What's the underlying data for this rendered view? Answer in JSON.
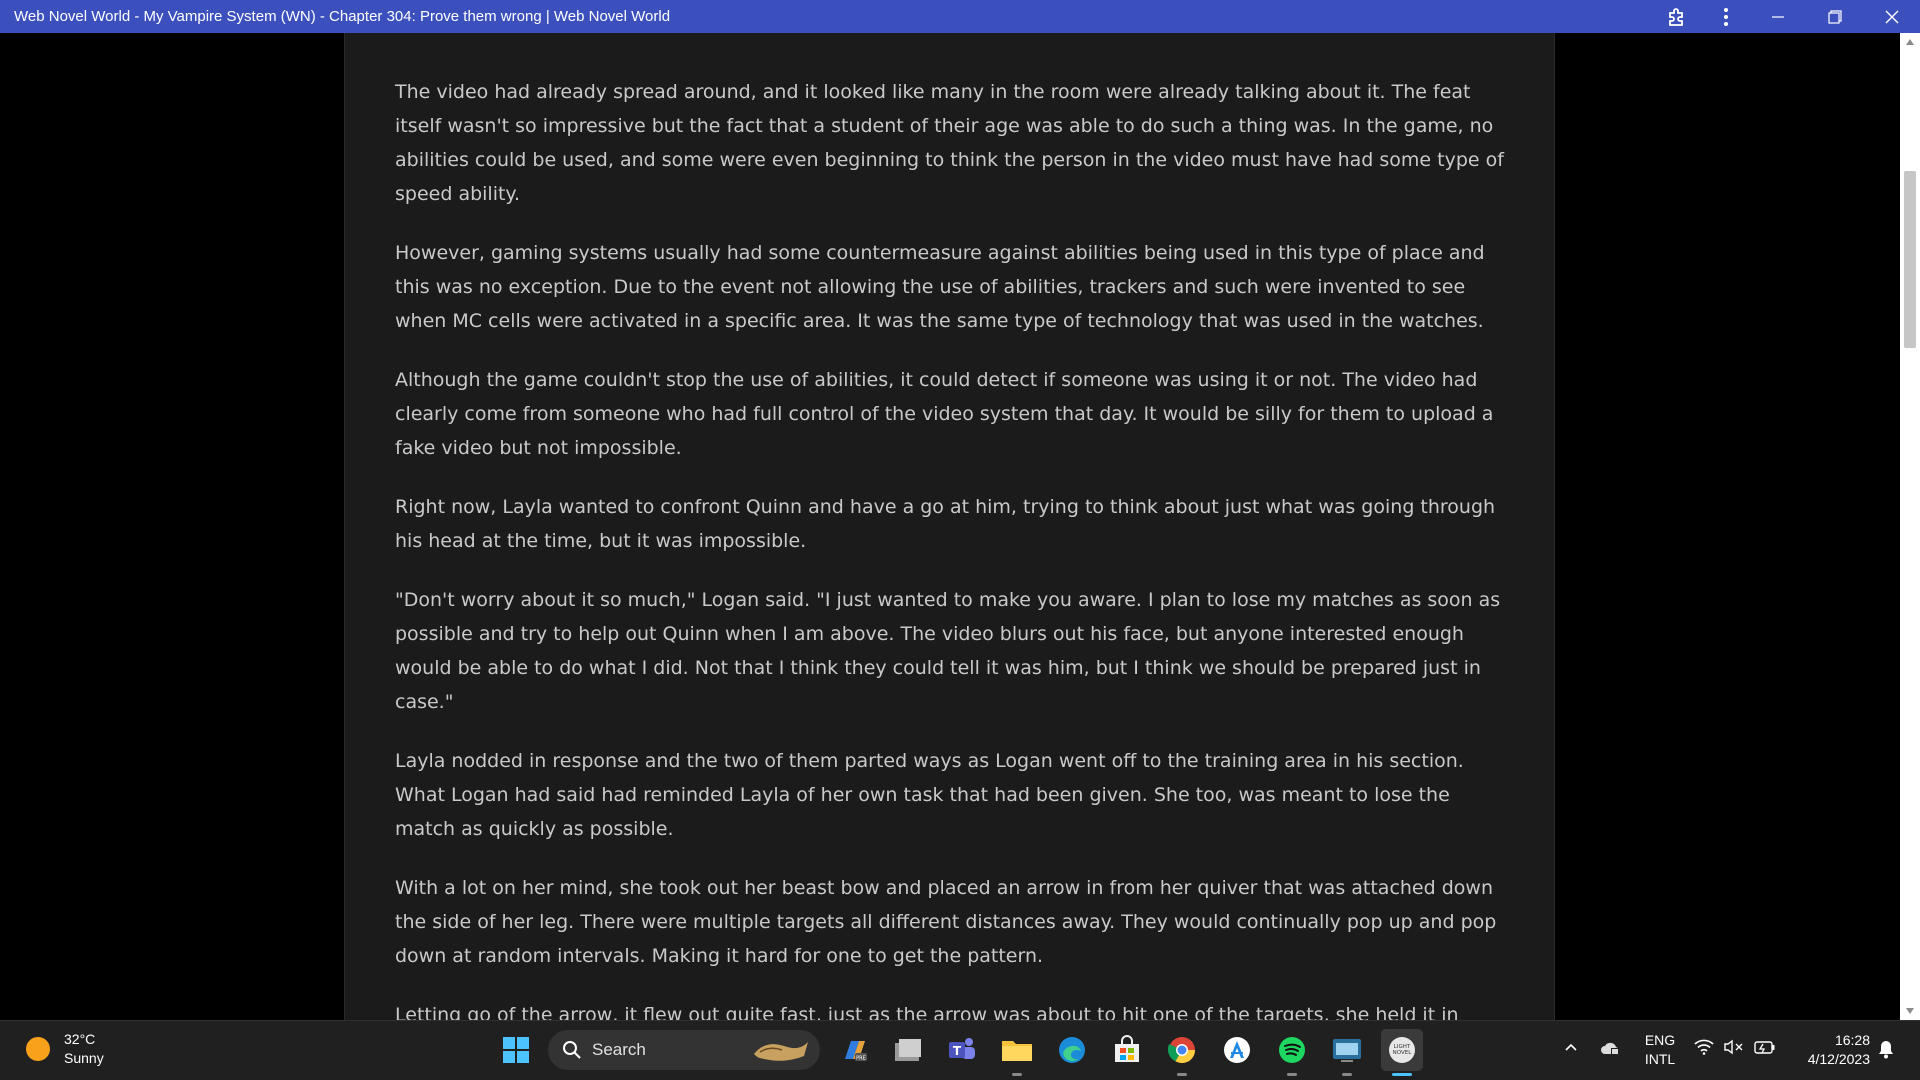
{
  "window": {
    "title": "Web Novel World - My Vampire System (WN) - Chapter 304: Prove them wrong | Web Novel World"
  },
  "article": {
    "paragraphs": [
      "The video had already spread around, and it looked like many in the room were already talking about it. The feat itself wasn't so impressive but the fact that a student of their age was able to do such a thing was. In the game, no abilities could be used, and some were even beginning to think the person in the video must have had some type of speed ability.",
      "However, gaming systems usually had some countermeasure against abilities being used in this type of place and this was no exception. Due to the event not allowing the use of abilities, trackers and such were invented to see when MC cells were activated in a specific area. It was the same type of technology that was used in the watches.",
      "Although the game couldn't stop the use of abilities, it could detect if someone was using it or not. The video had clearly come from someone who had full control of the video system that day. It would be silly for them to upload a fake video but not impossible.",
      "Right now, Layla wanted to confront Quinn and have a go at him, trying to think about just what was going through his head at the time, but it was impossible.",
      "\"Don't worry about it so much,\" Logan said. \"I just wanted to make you aware. I plan to lose my matches as soon as possible and try to help out Quinn when I am above. The video blurs out his face, but anyone interested enough would be able to do what I did. Not that I think they could tell it was him, but I think we should be prepared just in case.\"",
      "Layla nodded in response and the two of them parted ways as Logan went off to the training area in his section. What Logan had said had reminded Layla of her own task that had been given. She too, was meant to lose the match as quickly as possible.",
      "With a lot on her mind, she took out her beast bow and placed an arrow in from her quiver that was attached down the side of her leg. There were multiple targets all different distances away. They would continually pop up and pop down at random intervals. Making it hard for one to get the pattern.",
      "Letting go of the arrow, it flew out quite fast, just as the arrow was about to hit one of the targets, she held it in place with her ability. When the target popped back up again, she allowed it to go forward and hit."
    ]
  },
  "taskbar": {
    "weather": {
      "temp": "32°C",
      "condition": "Sunny"
    },
    "search_label": "Search",
    "language": {
      "line1": "ENG",
      "line2": "INTL"
    },
    "clock": {
      "time": "16:28",
      "date": "4/12/2023"
    },
    "apps": [
      "start-icon",
      "search-icon",
      "copilot-pre-icon",
      "file-manager-icon",
      "teams-icon",
      "file-explorer-icon",
      "edge-icon",
      "store-icon",
      "chrome-icon",
      "app-a-icon",
      "spotify-icon",
      "screen-app-icon",
      "light-novel-world-icon"
    ]
  },
  "colors": {
    "titlebar": "#3c50bd",
    "reader_bg": "#1b1b1b",
    "text": "#c9c9c9",
    "taskbar": "#202020"
  }
}
